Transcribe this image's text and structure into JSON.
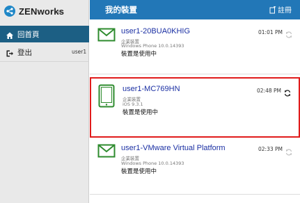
{
  "app": {
    "brand_name": "ZENworks",
    "brand_mark": "®"
  },
  "sidebar": {
    "home_label": "回首頁",
    "logout_label": "登出",
    "username": "user1"
  },
  "header": {
    "title": "我的裝置",
    "register_label": "註冊"
  },
  "devices": [
    {
      "name": "user1-20BUA0KHIG",
      "type": "企業裝置",
      "os": "Windows Phone 10.0.14393",
      "status": "裝置是使用中",
      "time": "01:01 PM",
      "icon": "mail-icon",
      "sync_active": false
    },
    {
      "name": "user1-MC769HN",
      "type": "企業裝置",
      "os": "iOS 9.3.1",
      "status": "裝置是使用中",
      "time": "02:48 PM",
      "icon": "tablet-icon",
      "sync_active": true
    },
    {
      "name": "user1-VMware Virtual Platform",
      "type": "企業裝置",
      "os": "Windows Phone 10.0.14393",
      "status": "裝置是使用中",
      "time": "02:33 PM",
      "icon": "mail-icon",
      "sync_active": false
    }
  ],
  "colors": {
    "header_bg": "#2277b7",
    "nav_active_bg": "#1c5f84",
    "device_name": "#1a2fa3",
    "device_icon": "#2e8b2e",
    "highlight_border": "#e01b1b"
  }
}
